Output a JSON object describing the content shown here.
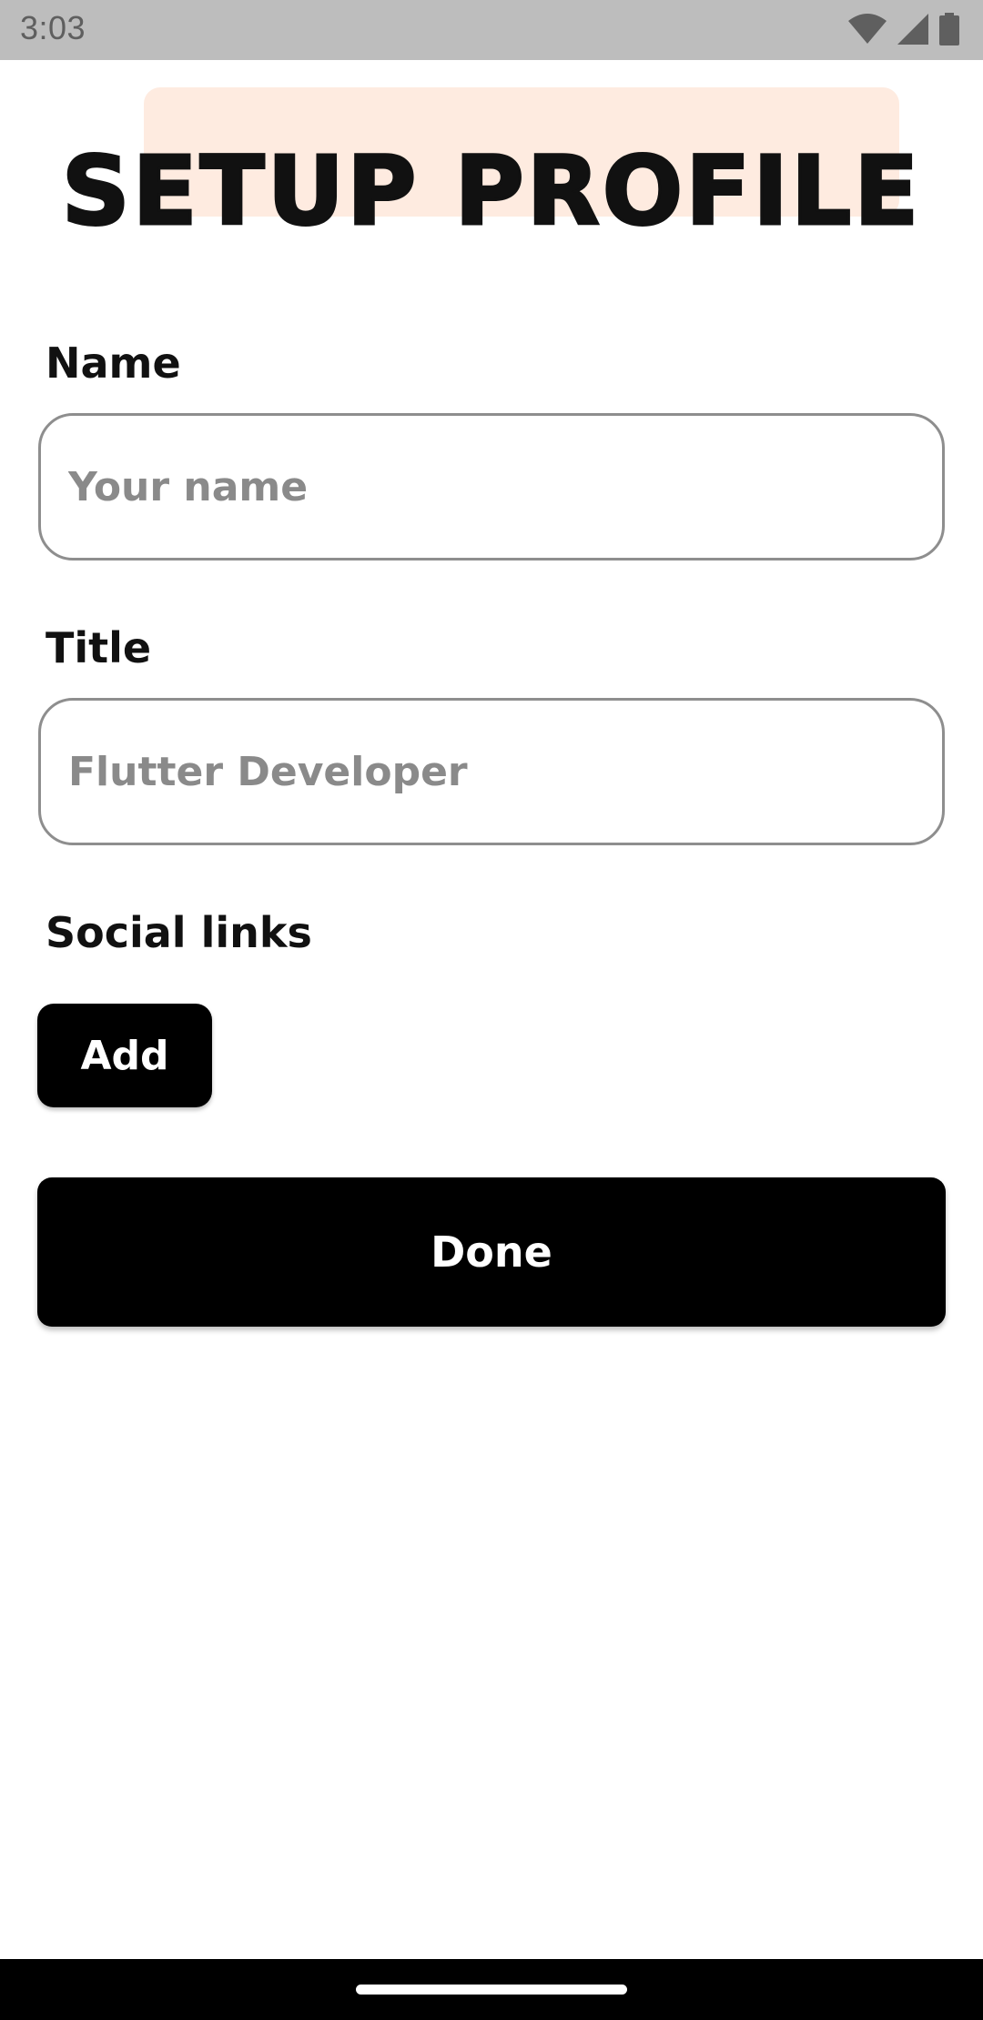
{
  "status_bar": {
    "time": "3:03",
    "icons": [
      "wifi-icon",
      "signal-icon",
      "battery-icon"
    ]
  },
  "header": {
    "title": "SETUP PROFILE",
    "title_highlight_color": "#feebe0"
  },
  "form": {
    "name": {
      "label": "Name",
      "placeholder": "Your name",
      "value": ""
    },
    "title": {
      "label": "Title",
      "placeholder": "Flutter Developer",
      "value": ""
    },
    "social_links": {
      "label": "Social links",
      "add_label": "Add"
    }
  },
  "actions": {
    "done_label": "Done"
  },
  "colors": {
    "button_bg": "#000000",
    "button_text": "#ffffff",
    "field_border": "#8e8e8e",
    "placeholder": "#8a8a8a"
  }
}
